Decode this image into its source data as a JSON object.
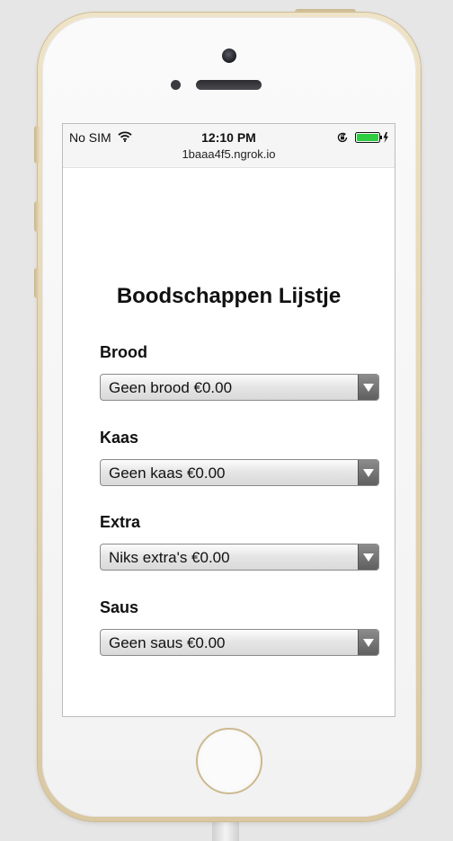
{
  "status_bar": {
    "carrier": "No SIM",
    "time": "12:10 PM",
    "url": "1baaa4f5.ngrok.io",
    "icons": [
      "wifi-icon",
      "rotation-lock-icon",
      "battery-charging-icon"
    ]
  },
  "page": {
    "title": "Boodschappen Lijstje"
  },
  "fields": [
    {
      "label": "Brood",
      "selected": "Geen brood €0.00"
    },
    {
      "label": "Kaas",
      "selected": "Geen kaas €0.00"
    },
    {
      "label": "Extra",
      "selected": "Niks extra's €0.00"
    },
    {
      "label": "Saus",
      "selected": "Geen saus €0.00"
    }
  ],
  "colors": {
    "phone_frame": "#e4d5b2",
    "battery_fill": "#2ecc40"
  }
}
